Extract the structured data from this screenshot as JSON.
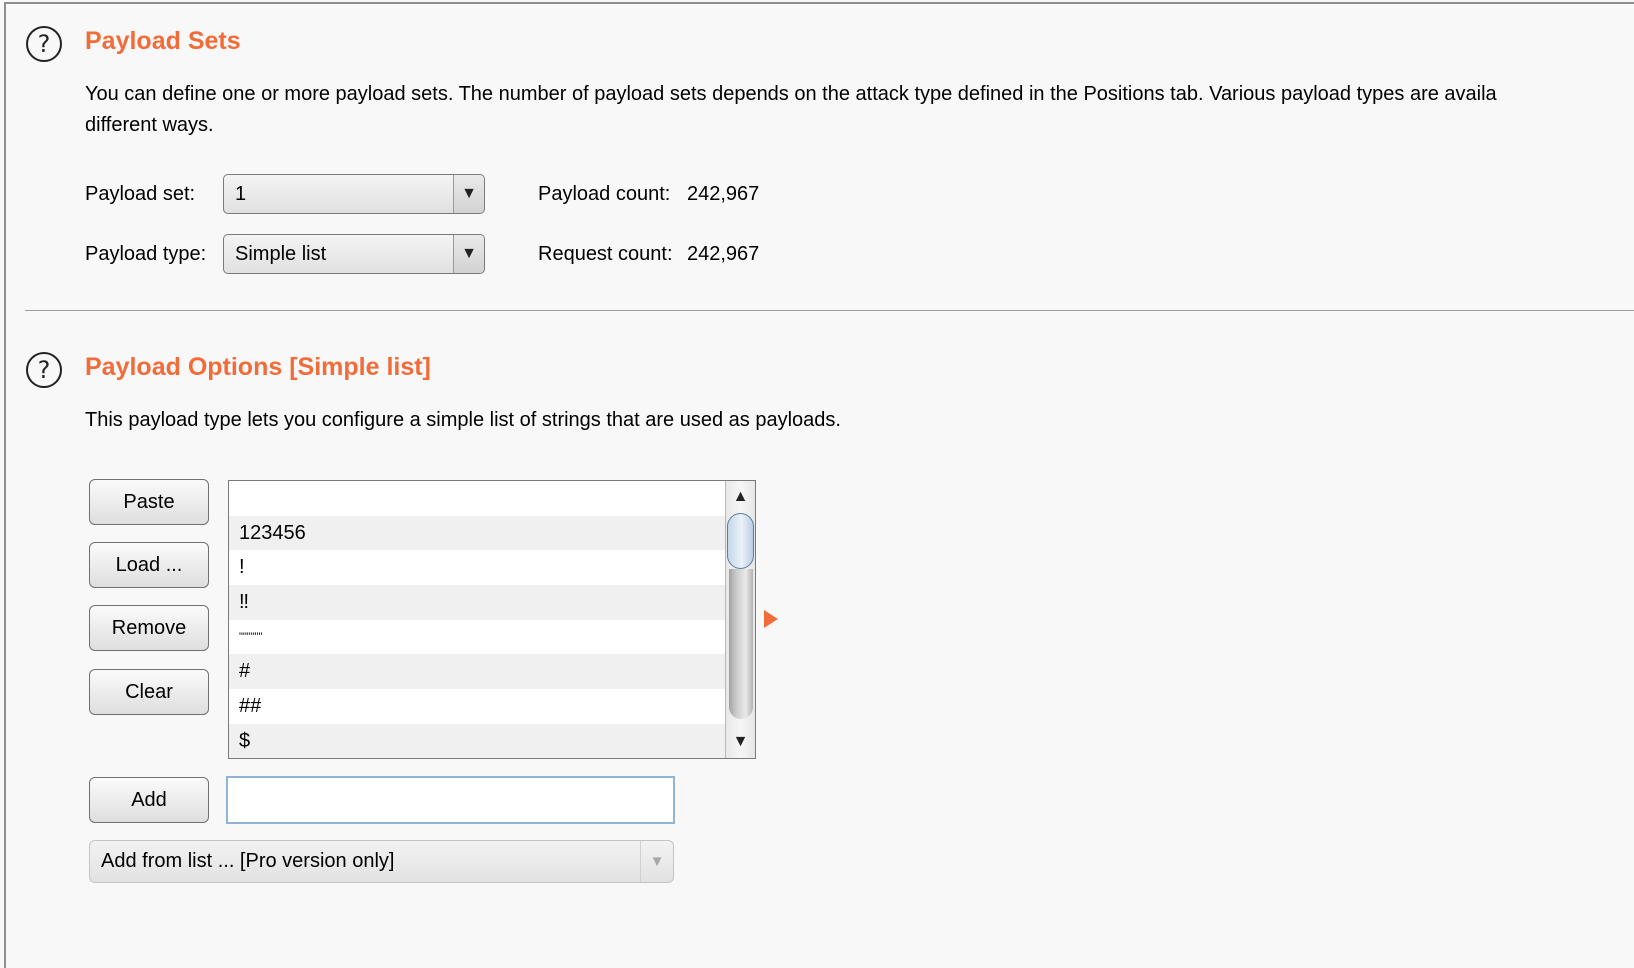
{
  "payload_sets": {
    "help_icon": "?",
    "title": "Payload Sets",
    "description_line1": "You can define one or more payload sets. The number of payload sets depends on the attack type defined in the Positions tab. Various payload types are availa",
    "description_line2": "different ways.",
    "payload_set_label": "Payload set:",
    "payload_set_value": "1",
    "payload_type_label": "Payload type:",
    "payload_type_value": "Simple list",
    "payload_count_label": "Payload count:",
    "payload_count_value": "242,967",
    "request_count_label": "Request count:",
    "request_count_value": "242,967"
  },
  "payload_options": {
    "help_icon": "?",
    "title": "Payload Options [Simple list]",
    "description": "This payload type lets you configure a simple list of strings that are used as payloads.",
    "buttons": {
      "paste": "Paste",
      "load": "Load ...",
      "remove": "Remove",
      "clear": "Clear",
      "add": "Add"
    },
    "list_items": [
      "",
      "123456",
      "!",
      "‼",
      "\"\"\"\"\"\"",
      "#",
      "##",
      "$"
    ],
    "scroll_up_icon": "triangle-up-icon",
    "scroll_down_icon": "triangle-down-icon",
    "add_input_value": "",
    "add_from_list": "Add from list ... [Pro version only]"
  },
  "colors": {
    "accent": "#f26c3a",
    "background": "#f8f8f8"
  }
}
